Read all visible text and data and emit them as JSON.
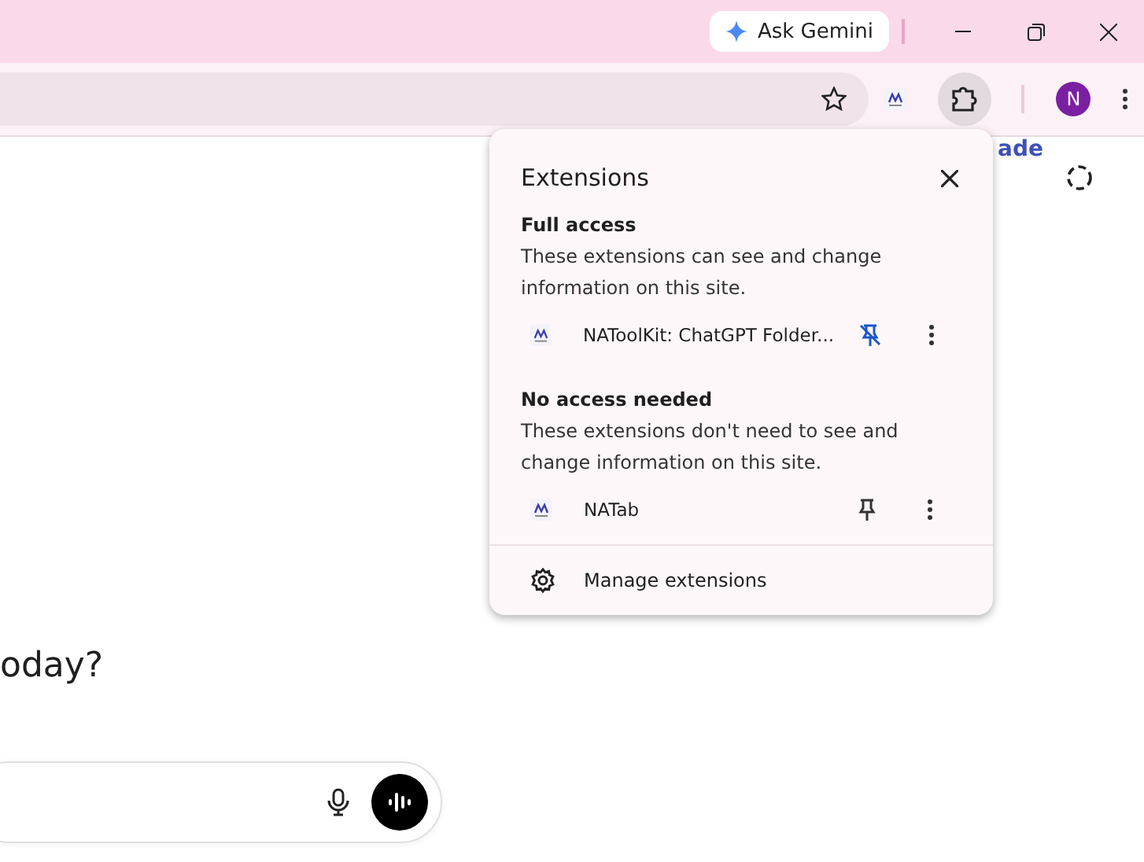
{
  "title_bar": {
    "ask_button": "Ask Gemini"
  },
  "toolbar": {
    "bookmarked": false,
    "profile_initial": "N"
  },
  "page": {
    "link": "ade",
    "heading": "oday?"
  },
  "extensions_popup": {
    "title": "Extensions",
    "sections": [
      {
        "heading": "Full access",
        "description": "These extensions can see and change information on this site.",
        "items": [
          {
            "name": "NAToolKit: ChatGPT Folder...",
            "pinned": true
          }
        ]
      },
      {
        "heading": "No access needed",
        "description": "These extensions don't need to see and change information on this site.",
        "items": [
          {
            "name": "NATab",
            "pinned": false
          }
        ]
      }
    ],
    "footer": "Manage extensions"
  }
}
